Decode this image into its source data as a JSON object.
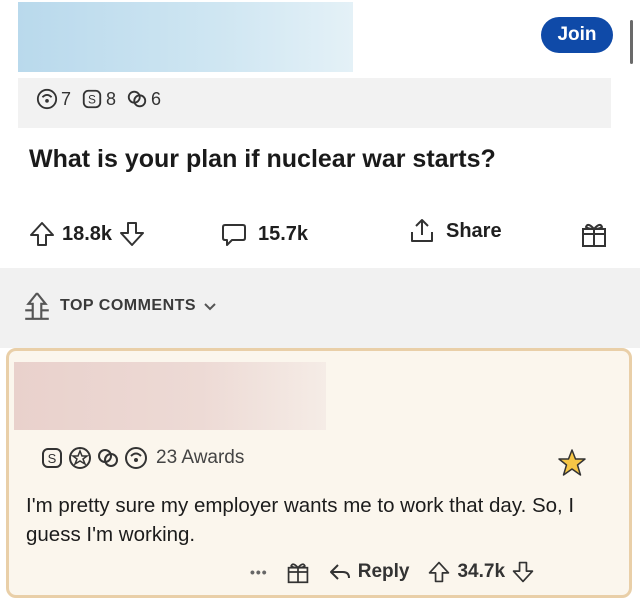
{
  "header": {
    "join_label": "Join"
  },
  "post": {
    "awards": [
      {
        "icon": "helpful-award-icon",
        "count": "7"
      },
      {
        "icon": "silver-award-icon",
        "count": "8"
      },
      {
        "icon": "wholesome-award-icon",
        "count": "6"
      }
    ],
    "title": "What is your plan if nuclear war starts?",
    "upvotes": "18.8k",
    "comments": "15.7k",
    "share_label": "Share"
  },
  "comments_section": {
    "label": "TOP COMMENTS"
  },
  "comment": {
    "awards_label": "23 Awards",
    "body": "I'm pretty sure my employer wants me to work that day. So, I guess I'm working.",
    "more_label": "•••",
    "reply_label": "Reply",
    "score": "34.7k"
  },
  "colors": {
    "join": "#0f4aa8",
    "card_border": "#e9cfa8",
    "card_bg": "#fbf6ed"
  }
}
